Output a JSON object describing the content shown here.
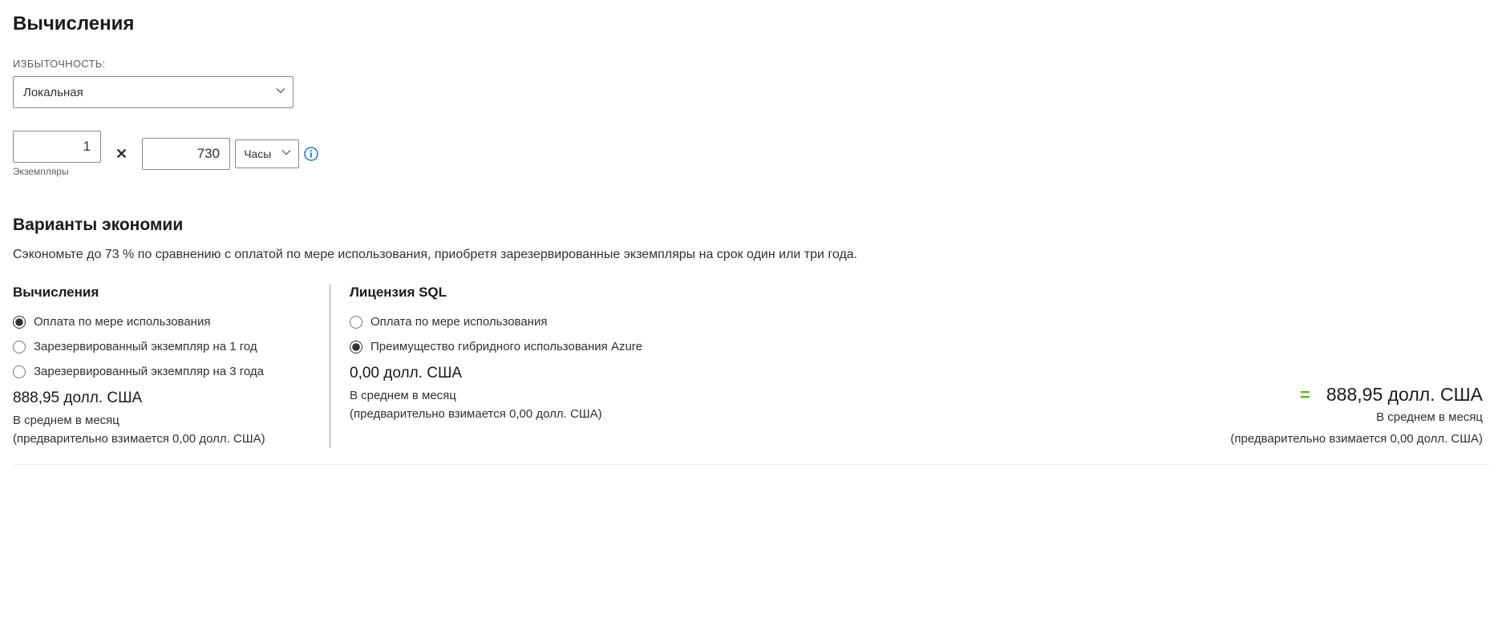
{
  "compute": {
    "title": "Вычисления",
    "redundancy_label": "ИЗБЫТОЧНОСТЬ:",
    "redundancy_value": "Локальная",
    "instances_value": "1",
    "instances_label": "Экземпляры",
    "multiply_symbol": "✕",
    "duration_value": "730",
    "duration_unit": "Часы"
  },
  "savings": {
    "title": "Варианты экономии",
    "desc": "Сэкономьте до 73 % по сравнению с оплатой по мере использования, приобретя зарезервированные экземпляры на срок один или три года.",
    "compute_col": {
      "title": "Вычисления",
      "options": [
        "Оплата по мере использования",
        "Зарезервированный экземпляр на 1 год",
        "Зарезервированный экземпляр на 3 года"
      ],
      "price": "888,95 долл. США",
      "avg": "В среднем в месяц",
      "upfront": "(предварительно взимается 0,00 долл. США)"
    },
    "sql_col": {
      "title": "Лицензия SQL",
      "options": [
        "Оплата по мере использования",
        "Преимущество гибридного использования Azure"
      ],
      "price": "0,00 долл. США",
      "avg": "В среднем в месяц",
      "upfront": "(предварительно взимается 0,00 долл. США)"
    },
    "total": {
      "equals": "=",
      "price": "888,95 долл. США",
      "avg": "В среднем в месяц",
      "upfront": "(предварительно взимается 0,00 долл. США)"
    }
  }
}
